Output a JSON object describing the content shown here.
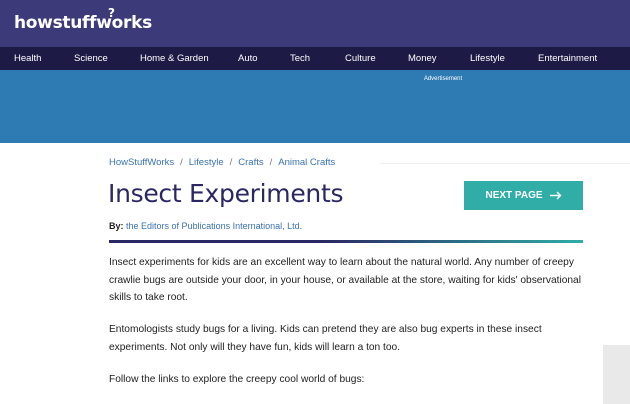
{
  "header": {
    "logo_text": "howstuffworks",
    "logo_mark": "?"
  },
  "nav": {
    "items": [
      "Health",
      "Science",
      "Home & Garden",
      "Auto",
      "Tech",
      "Culture",
      "Money",
      "Lifestyle",
      "Entertainment"
    ]
  },
  "ad": {
    "label": "Advertisement"
  },
  "breadcrumb": {
    "items": [
      "HowStuffWorks",
      "Lifestyle",
      "Crafts",
      "Animal Crafts"
    ],
    "separator": "/"
  },
  "article": {
    "title": "Insect Experiments",
    "byline_prefix": "By:",
    "author": "the Editors of Publications International, Ltd.",
    "paragraphs": [
      "Insect experiments for kids are an excellent way to learn about the natural world. Any number of creepy crawlie bugs are outside your door, in your house, or available at the store, waiting for kids' observational skills to take root.",
      "Entomologists study bugs for a living. Kids can pretend they are also bug experts in these insect experiments. Not only will they have fun, kids will learn a ton too.",
      "Follow the links to explore the creepy cool world of bugs:"
    ]
  },
  "next_button": {
    "label": "NEXT PAGE",
    "icon": "arrow-right-icon"
  },
  "colors": {
    "header_bg": "#3d3a7a",
    "nav_bg": "#1d1a46",
    "ad_bg": "#2e7bb4",
    "title": "#2b2762",
    "link": "#3a72b0",
    "accent": "#2fada6"
  }
}
